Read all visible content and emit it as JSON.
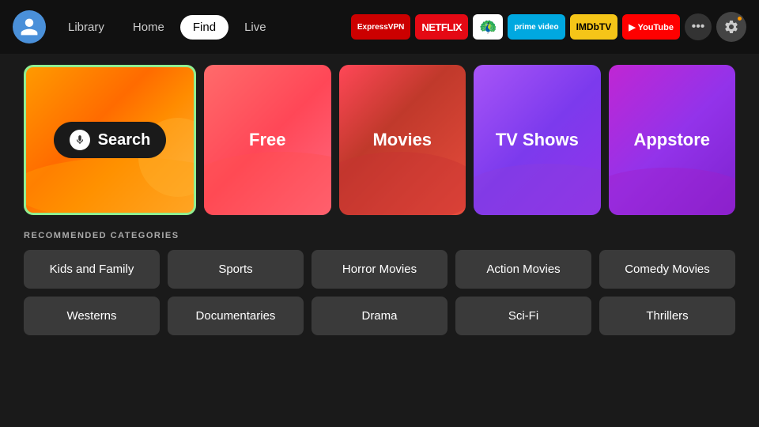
{
  "nav": {
    "links": [
      {
        "label": "Library",
        "active": false
      },
      {
        "label": "Home",
        "active": false
      },
      {
        "label": "Find",
        "active": true
      },
      {
        "label": "Live",
        "active": false
      }
    ],
    "apps": [
      {
        "label": "ExpressVPN",
        "class": "badge-express"
      },
      {
        "label": "NETFLIX",
        "class": "badge-netflix"
      },
      {
        "label": "🦚",
        "class": "badge-peacock"
      },
      {
        "label": "prime video",
        "class": "badge-prime"
      },
      {
        "label": "IMDbTV",
        "class": "badge-imdb"
      },
      {
        "label": "▶ YouTube",
        "class": "badge-youtube"
      }
    ],
    "more_label": "•••",
    "settings_label": "⚙"
  },
  "featured": {
    "tiles": [
      {
        "id": "search",
        "label": "Search",
        "type": "search"
      },
      {
        "id": "free",
        "label": "Free",
        "type": "free"
      },
      {
        "id": "movies",
        "label": "Movies",
        "type": "movies"
      },
      {
        "id": "tvshows",
        "label": "TV Shows",
        "type": "tvshows"
      },
      {
        "id": "appstore",
        "label": "Appstore",
        "type": "appstore"
      }
    ]
  },
  "categories": {
    "title": "RECOMMENDED CATEGORIES",
    "items": [
      "Kids and Family",
      "Sports",
      "Horror Movies",
      "Action Movies",
      "Comedy Movies",
      "Westerns",
      "Documentaries",
      "Drama",
      "Sci-Fi",
      "Thrillers"
    ]
  },
  "icons": {
    "mic": "🎤",
    "gear": "⚙",
    "dots": "•••"
  }
}
